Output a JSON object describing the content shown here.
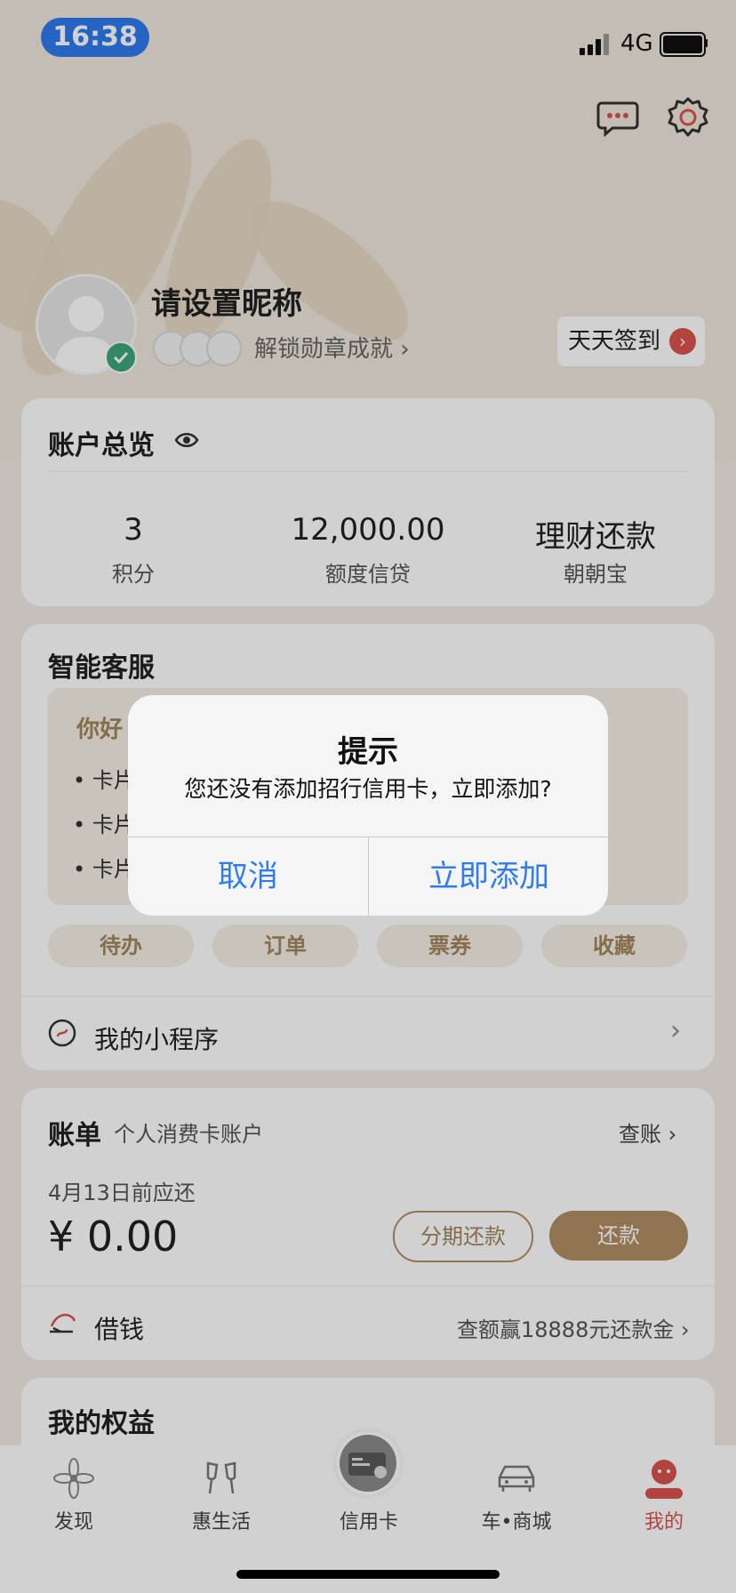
{
  "status_bar": {
    "time": "16:38",
    "network": "4G"
  },
  "profile": {
    "nickname": "请设置昵称",
    "unlock_text": "解锁勋章成就",
    "checkin_label": "天天签到"
  },
  "account": {
    "title": "账户总览",
    "stats": [
      {
        "value": "3",
        "label": "积分"
      },
      {
        "value": "12,000.00",
        "label": "额度信贷"
      },
      {
        "value": "理财还款",
        "label": "朝朝宝"
      }
    ]
  },
  "service": {
    "title": "智能客服",
    "greeting": "你好",
    "items": [
      "卡片",
      "卡片",
      "卡片"
    ],
    "quick": [
      "待办",
      "订单",
      "票券",
      "收藏"
    ],
    "mini_program": "我的小程序"
  },
  "bill": {
    "title": "账单",
    "subtitle": "个人消费卡账户",
    "check": "查账",
    "due": "4月13日前应还",
    "amount": "¥ 0.00",
    "installment": "分期还款",
    "repay": "还款",
    "borrow": "借钱",
    "borrow_promo": "查额赢18888元还款金"
  },
  "rights": {
    "title": "我的权益"
  },
  "dialog": {
    "title": "提示",
    "message": "您还没有添加招行信用卡，立即添加?",
    "cancel": "取消",
    "confirm": "立即添加"
  },
  "tabs": [
    {
      "label": "发现",
      "icon": "flower-icon"
    },
    {
      "label": "惠生活",
      "icon": "cheers-icon"
    },
    {
      "label": "信用卡",
      "icon": "card-icon"
    },
    {
      "label": "车•商城",
      "icon": "car-icon"
    },
    {
      "label": "我的",
      "icon": "user-icon"
    }
  ],
  "colors": {
    "accent": "#b08d63",
    "active_tab": "#d9534f",
    "dialog_button": "#2f7bf0"
  }
}
